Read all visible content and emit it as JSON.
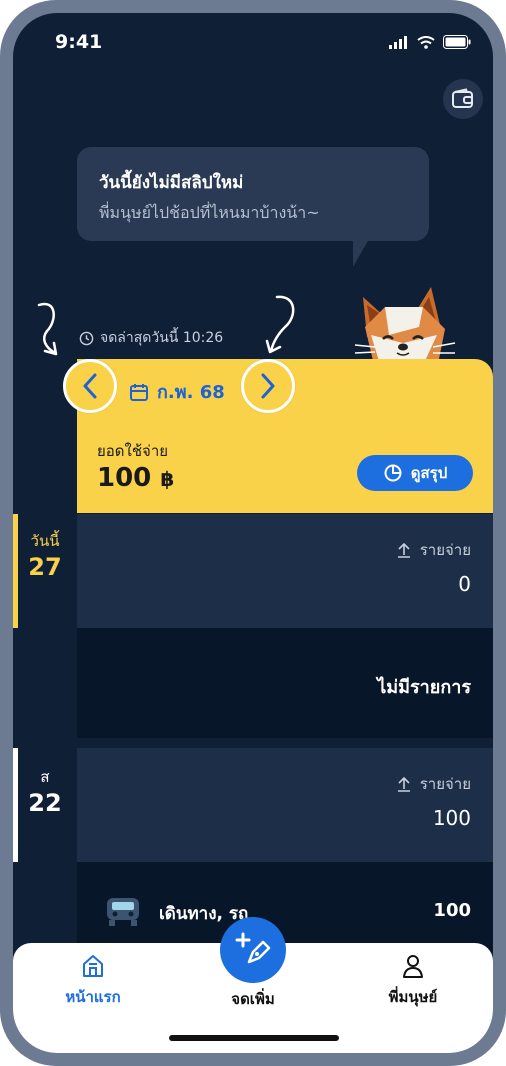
{
  "status_bar": {
    "time": "9:41"
  },
  "speech_bubble": {
    "title": "วันนี้ยังไม่มีสลิปใหม่",
    "subtitle": "พี่มนุษย์ไปช้อปที่ไหนมาบ้างน้า~"
  },
  "last_recorded": "จดล่าสุดวันนี้ 10:26",
  "month_selector": {
    "label": "ก.พ. 68"
  },
  "spending": {
    "label": "ยอดใช้จ่าย",
    "value": "100",
    "currency": "฿",
    "summary_button": "ดูสรุป"
  },
  "days": [
    {
      "weekday": "วันนี้",
      "day": "27",
      "accent": "#f9d24a",
      "expense_label": "รายจ่าย",
      "expense_value": "0",
      "empty_text": "ไม่มีรายการ"
    },
    {
      "weekday": "ส",
      "day": "22",
      "accent": "#ffffff",
      "expense_label": "รายจ่าย",
      "expense_value": "100",
      "transactions": [
        {
          "icon": "car-icon",
          "title": "เดินทาง, รถ",
          "amount": "100"
        }
      ]
    }
  ],
  "bottom_nav": {
    "home": "หน้าแรก",
    "add": "จดเพิ่ม",
    "profile": "พี่มนุษย์"
  },
  "colors": {
    "background": "#0f1f36",
    "yellow": "#f9d24a",
    "accent_blue": "#1d6fe0",
    "frame": "#6c7a92"
  }
}
